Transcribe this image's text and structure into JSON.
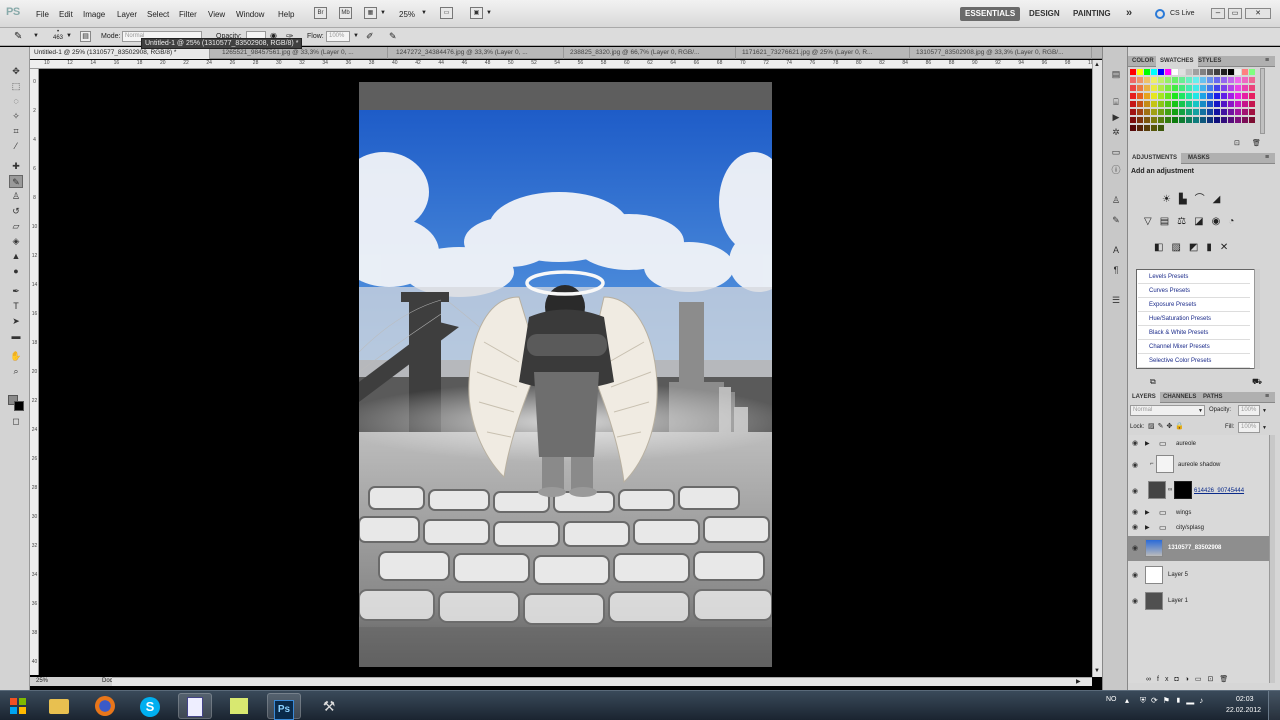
{
  "app": {
    "logo": "PS"
  },
  "menu": [
    "File",
    "Edit",
    "Image",
    "Layer",
    "Select",
    "Filter",
    "View",
    "Window",
    "Help"
  ],
  "menubar": {
    "zoom": "25%",
    "workspaces": [
      "ESSENTIALS",
      "DESIGN",
      "PAINTING"
    ],
    "more": "»",
    "cs_live": "CS Live"
  },
  "options": {
    "brush_size": "463",
    "mode_label": "Mode:",
    "mode_value": "Normal",
    "opacity_label": "Opacity:",
    "opacity_value": "",
    "flow_label": "Flow:",
    "flow_value": "100%"
  },
  "tooltip": "Untitled-1 @ 25% (1310577_83502908, RGB/8) *",
  "doc_tabs": [
    "Untitled-1 @ 25% (1310577_83502908, RGB/8) *",
    "1265521_98457561.jpg @ 33,3% (Layer 0, ...",
    "1247272_34384476.jpg @ 33,3% (Layer 0, ...",
    "238825_8320.jpg @ 66,7% (Layer 0, RGB/...",
    "1171621_73276621.jpg @ 25% (Layer 0, R...",
    "1310577_83502908.jpg @ 33,3% (Layer 0, RGB/..."
  ],
  "ruler_top": [
    "10",
    "12",
    "14",
    "16",
    "18",
    "20",
    "22",
    "24",
    "26",
    "28",
    "30",
    "32",
    "34",
    "36",
    "38",
    "40",
    "42",
    "44",
    "46",
    "48",
    "50",
    "52",
    "54",
    "56",
    "58",
    "60",
    "62",
    "64",
    "66",
    "68",
    "70",
    "72",
    "74",
    "76",
    "78",
    "80",
    "82",
    "84",
    "86",
    "88",
    "90",
    "92",
    "94",
    "96",
    "98",
    "100"
  ],
  "ruler_left": [
    "0",
    "2",
    "4",
    "6",
    "8",
    "10",
    "12",
    "14",
    "16",
    "18",
    "20",
    "22",
    "24",
    "26",
    "28",
    "30",
    "32",
    "34",
    "36",
    "38",
    "40"
  ],
  "status": {
    "zoom": "25%",
    "doc": "Doc: 24,9M/259,4M"
  },
  "color_panel": {
    "tabs": [
      "COLOR",
      "SWATCHES",
      "STYLES"
    ],
    "active": 1
  },
  "adjustments": {
    "tabs": [
      "ADJUSTMENTS",
      "MASKS"
    ],
    "heading": "Add an adjustment",
    "presets": [
      "Levels Presets",
      "Curves Presets",
      "Exposure Presets",
      "Hue/Saturation Presets",
      "Black & White Presets",
      "Channel Mixer Presets",
      "Selective Color Presets"
    ]
  },
  "layers_panel": {
    "tabs": [
      "LAYERS",
      "CHANNELS",
      "PATHS"
    ],
    "blend": "Normal",
    "opacity_label": "Opacity:",
    "opacity_value": "100%",
    "lock_label": "Lock:",
    "fill_label": "Fill:",
    "fill_value": "100%",
    "layers": [
      {
        "name": "aureole",
        "type": "group"
      },
      {
        "name": "aureole shadow",
        "type": "layer"
      },
      {
        "name": "614426_90745444",
        "type": "masked"
      },
      {
        "name": "wings",
        "type": "group"
      },
      {
        "name": "city/splasg",
        "type": "group"
      },
      {
        "name": "1310577_83502908",
        "type": "selected"
      },
      {
        "name": "Layer 5",
        "type": "layer"
      },
      {
        "name": "Layer 1",
        "type": "dark"
      }
    ]
  },
  "taskbar": {
    "lang": "NO",
    "time": "02:03",
    "date": "22.02.2012"
  },
  "colors": {
    "accent": "#6a6a6a",
    "sky": "#2a6ad8",
    "selected_layer": "#8e8e8e"
  }
}
